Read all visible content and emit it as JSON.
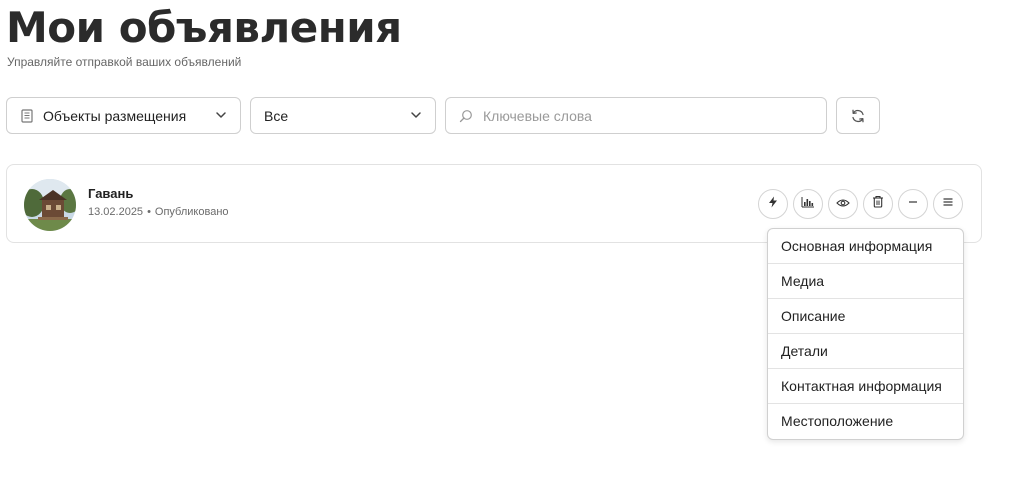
{
  "header": {
    "title": "Мои объявления",
    "subtitle": "Управляйте отправкой ваших объявлений"
  },
  "filters": {
    "category": {
      "icon": "building-icon",
      "value": "Объекты размещения"
    },
    "status": {
      "value": "Все"
    },
    "search": {
      "placeholder": "Ключевые слова",
      "value": ""
    },
    "refresh_icon": "refresh-icon"
  },
  "listing": {
    "name": "Гавань",
    "date": "13.02.2025",
    "separator": "•",
    "status": "Опубликовано",
    "actions": [
      "bolt-icon",
      "stats-icon",
      "eye-icon",
      "trash-icon",
      "minus-icon",
      "menu-icon"
    ]
  },
  "menu": {
    "items": [
      {
        "label": "Основная информация"
      },
      {
        "label": "Медиа"
      },
      {
        "label": "Описание"
      },
      {
        "label": "Детали"
      },
      {
        "label": "Контактная информация"
      },
      {
        "label": "Местоположение"
      }
    ]
  }
}
